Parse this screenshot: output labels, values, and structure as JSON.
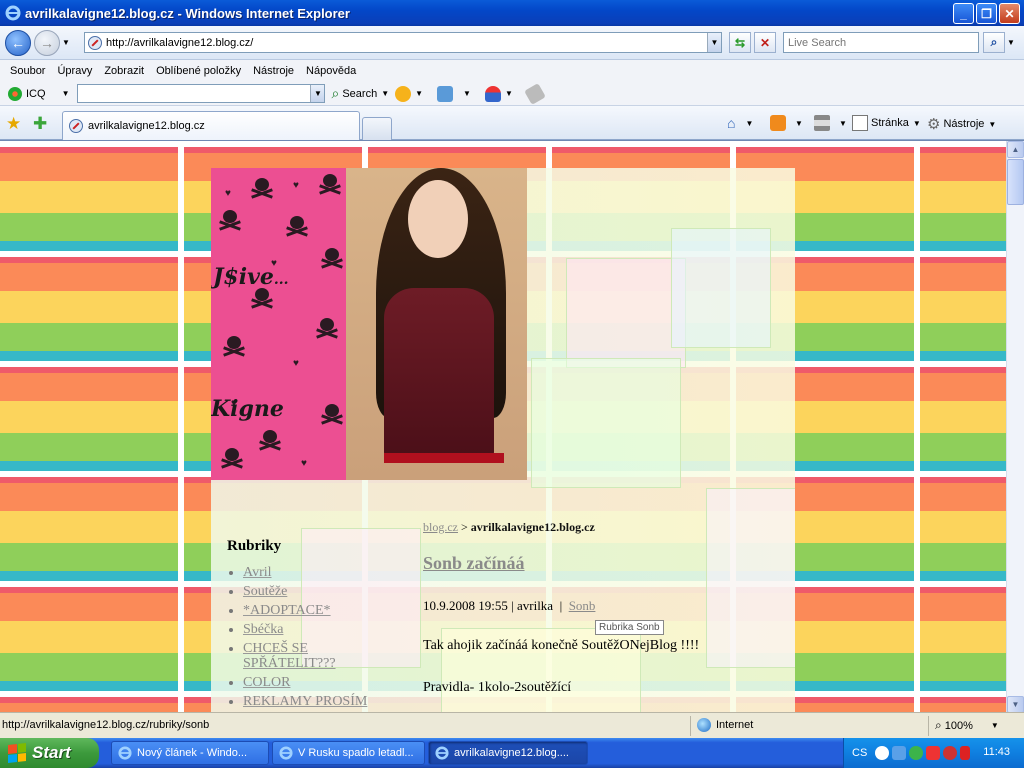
{
  "window": {
    "title": "avrilkalavigne12.blog.cz - Windows Internet Explorer",
    "minimize": "_",
    "maximize": "❐",
    "close": "✕"
  },
  "address_bar": {
    "url": "http://avrilkalavigne12.blog.cz/",
    "live_search_placeholder": "Live Search"
  },
  "menu": [
    "Soubor",
    "Úpravy",
    "Zobrazit",
    "Oblíbené položky",
    "Nástroje",
    "Nápověda"
  ],
  "toolbar": {
    "icq_label": "ICQ",
    "search_label": "Search"
  },
  "tabs": {
    "active_tab": "avrilkalavigne12.blog.cz",
    "home_label": "",
    "page_label": "Stránka",
    "tools_label": "Nástroje"
  },
  "page": {
    "banner_graffiti_1": "...",
    "sidebar": {
      "heading": "Rubriky",
      "items": [
        "Avril",
        "Soutěže",
        "*ADOPTACE*",
        "Sbéčka",
        "CHCEŠ SE SPŘÁTELIT???",
        "COLOR",
        "REKLAMY PROSÍM"
      ]
    },
    "article": {
      "crumb_link": "blog.cz",
      "crumb_sep": ">",
      "crumb_current": "avrilkalavigne12.blog.cz",
      "title": "Sonb začínáá",
      "date": "10.9.2008 19:55",
      "author": "avrilka",
      "category": "Sonb",
      "tooltip": "Rubrika Sonb",
      "para1": "Tak ahojik začínáá konečně SoutěžONejBlog !!!!",
      "para2": "Pravidla- 1kolo-2soutěžící"
    }
  },
  "statusbar": {
    "url": "http://avrilkalavigne12.blog.cz/rubriky/sonb",
    "zone": "Internet",
    "zoom": "100%"
  },
  "taskbar": {
    "start": "Start",
    "tasks": [
      "Nový článek - Windo...",
      "V Rusku spadlo letadl...",
      "avrilkalavigne12.blog...."
    ],
    "lang": "CS",
    "clock": "11:43"
  }
}
